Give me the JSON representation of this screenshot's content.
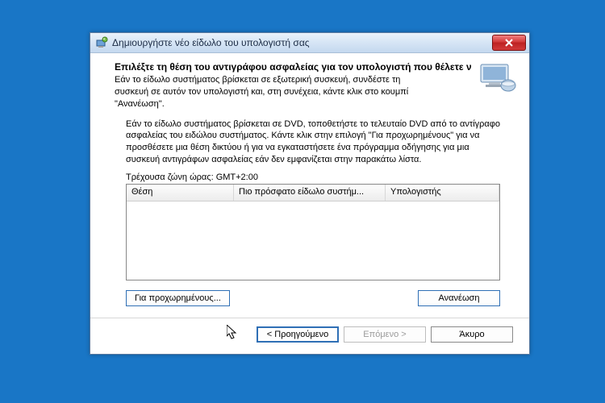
{
  "window": {
    "title": "Δημιουργήστε νέο είδωλο του υπολογιστή σας"
  },
  "main": {
    "heading": "Επιλέξτε τη θέση του αντιγράφου ασφαλείας για τον υπολογιστή που θέλετε να επαν",
    "sub_line1": "Εάν το είδωλο συστήματος βρίσκεται σε εξωτερική συσκευή, συνδέστε τη",
    "sub_line2": "συσκευή σε αυτόν τον υπολογιστή και, στη συνέχεια, κάντε κλικ στο κουμπί",
    "sub_line3": "\"Ανανέωση\".",
    "para": "Εάν το είδωλο συστήματος βρίσκεται σε DVD, τοποθετήστε το τελευταίο DVD από το αντίγραφο ασφαλείας του ειδώλου συστήματος. Κάντε κλικ στην επιλογή \"Για προχωρημένους\" για να προσθέσετε μια θέση δικτύου ή για να εγκαταστήσετε ένα πρόγραμμα οδήγησης για μια συσκευή αντιγράφων ασφαλείας εάν δεν εμφανίζεται στην παρακάτω λίστα.",
    "timezone": "Τρέχουσα ζώνη ώρας: GMT+2:00"
  },
  "table": {
    "col1": "Θέση",
    "col2": "Πιο πρόσφατο είδωλο συστήμ...",
    "col3": "Υπολογιστής"
  },
  "buttons": {
    "advanced": "Για προχωρημένους...",
    "refresh": "Ανανέωση",
    "back": "< Προηγούμενο",
    "next": "Επόμενο >",
    "cancel": "Άκυρο"
  }
}
